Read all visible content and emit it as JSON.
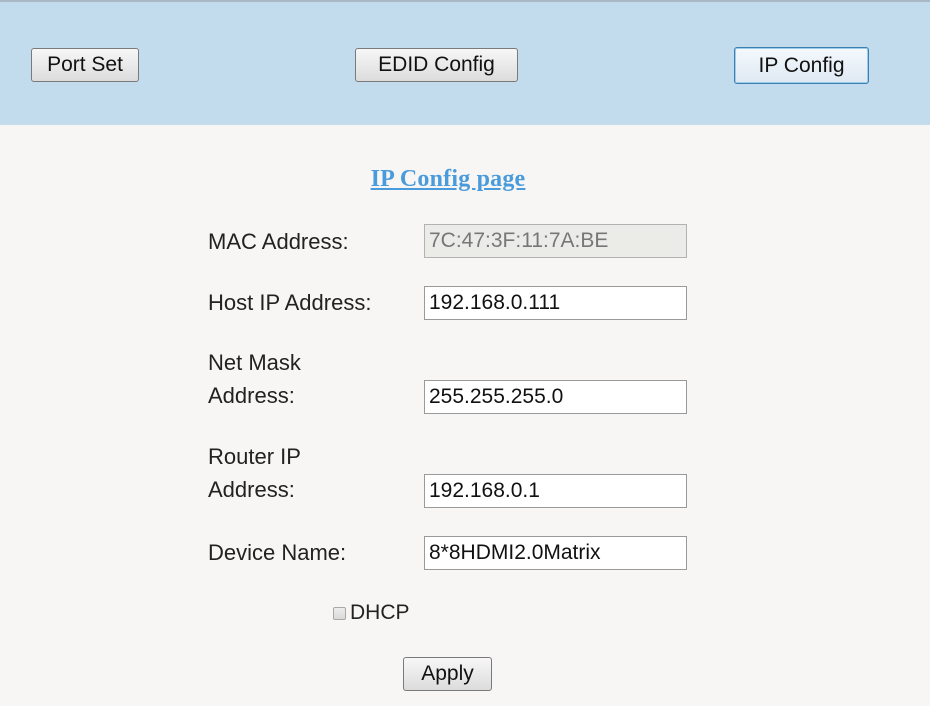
{
  "nav": {
    "port_set_label": "Port Set",
    "edid_config_label": "EDID Config",
    "ip_config_label": "IP Config",
    "active": "ip_config"
  },
  "page": {
    "title": "IP Config page"
  },
  "form": {
    "mac": {
      "label": "MAC Address:",
      "value": "7C:47:3F:11:7A:BE"
    },
    "host_ip": {
      "label": "Host IP Address:",
      "value": "192.168.0.111"
    },
    "net_mask": {
      "label_line1": "Net Mask",
      "label_line2": "Address:",
      "value": "255.255.255.0"
    },
    "router_ip": {
      "label_line1": "Router IP",
      "label_line2": "Address:",
      "value": "192.168.0.1"
    },
    "device_name": {
      "label": "Device Name:",
      "value": "8*8HDMI2.0Matrix"
    },
    "dhcp": {
      "label": "DHCP",
      "checked": false
    },
    "apply_label": "Apply"
  },
  "colors": {
    "header_bg": "#c2dced",
    "page_bg": "#f8f6f5",
    "title": "#4a9bdc",
    "active_button_border": "#3c7fb1"
  }
}
